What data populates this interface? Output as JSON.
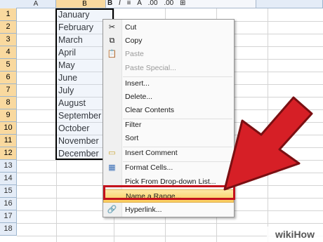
{
  "columns": [
    "A",
    "B"
  ],
  "rows": [
    "1",
    "2",
    "3",
    "4",
    "5",
    "6",
    "7",
    "8",
    "9",
    "10",
    "11",
    "12",
    "13",
    "14",
    "15",
    "16",
    "17",
    "18"
  ],
  "cells_b": [
    "January",
    "February",
    "March",
    "April",
    "May",
    "June",
    "July",
    "August",
    "September",
    "October",
    "November",
    "December"
  ],
  "mini_toolbar": [
    "B",
    "I",
    "≡",
    "A",
    ".00",
    ".00",
    "⊞"
  ],
  "context_menu": {
    "items": [
      {
        "label": "Cut",
        "icon": "scissors-icon",
        "glyph": "✂",
        "disabled": false
      },
      {
        "label": "Copy",
        "icon": "copy-icon",
        "glyph": "⧉",
        "disabled": false
      },
      {
        "label": "Paste",
        "icon": "paste-icon",
        "glyph": "📋",
        "disabled": true
      },
      {
        "label": "Paste Special...",
        "icon": "",
        "glyph": "",
        "disabled": true
      },
      {
        "label": "Insert...",
        "icon": "",
        "glyph": "",
        "disabled": false
      },
      {
        "label": "Delete...",
        "icon": "",
        "glyph": "",
        "disabled": false
      },
      {
        "label": "Clear Contents",
        "icon": "",
        "glyph": "",
        "disabled": false
      },
      {
        "label": "Filter",
        "icon": "",
        "glyph": "",
        "disabled": false
      },
      {
        "label": "Sort",
        "icon": "",
        "glyph": "",
        "disabled": false
      },
      {
        "label": "Insert Comment",
        "icon": "comment-icon",
        "glyph": "▭",
        "disabled": false
      },
      {
        "label": "Format Cells...",
        "icon": "format-cells-icon",
        "glyph": "▦",
        "disabled": false
      },
      {
        "label": "Pick From Drop-down List...",
        "icon": "",
        "glyph": "",
        "disabled": false
      },
      {
        "label": "Name a Range...",
        "icon": "",
        "glyph": "",
        "disabled": false
      },
      {
        "label": "Hyperlink...",
        "icon": "hyperlink-icon",
        "glyph": "🔗",
        "disabled": false
      }
    ]
  },
  "watermark": "wikiHow",
  "colors": {
    "highlight": "#f9cb5a",
    "callout": "#c4121c",
    "arrow": "#d61f26",
    "header_bg": "#e4ecf7",
    "header_selected": "#f9d99f"
  }
}
